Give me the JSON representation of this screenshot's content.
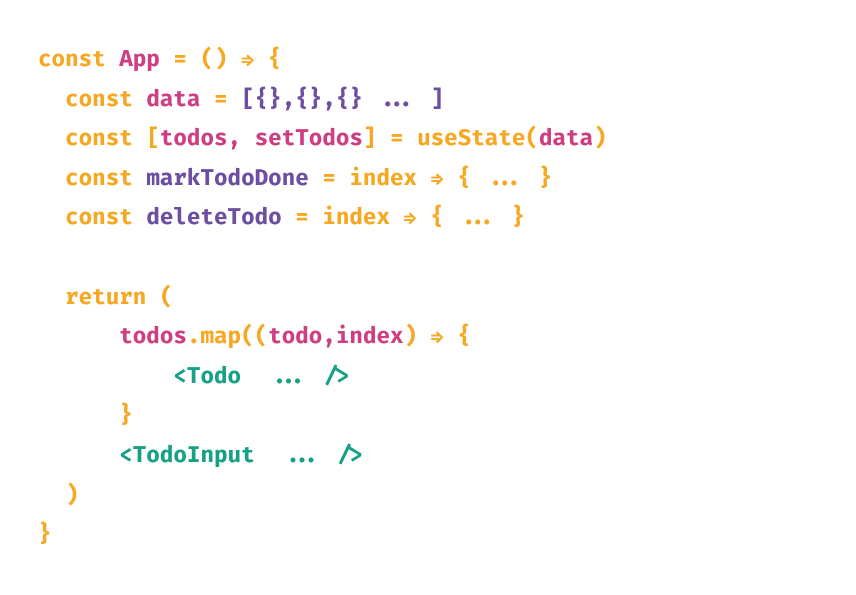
{
  "colors": {
    "orange": "#F6A823",
    "pink": "#CE3E82",
    "purple": "#6C4FA0",
    "teal": "#16A085"
  },
  "code": {
    "lines": [
      {
        "indent": 0,
        "tokens": [
          {
            "t": "const ",
            "c": "orange"
          },
          {
            "t": "App",
            "c": "pink"
          },
          {
            "t": " = () ",
            "c": "orange"
          },
          {
            "t": "⇒",
            "c": "orange"
          },
          {
            "t": " {",
            "c": "orange"
          }
        ]
      },
      {
        "indent": 1,
        "tokens": [
          {
            "t": "const ",
            "c": "orange"
          },
          {
            "t": "data",
            "c": "pink"
          },
          {
            "t": " = ",
            "c": "orange"
          },
          {
            "t": "[{},{},{} ... ]",
            "c": "purple"
          }
        ]
      },
      {
        "indent": 1,
        "tokens": [
          {
            "t": "const ",
            "c": "orange"
          },
          {
            "t": "[",
            "c": "orange"
          },
          {
            "t": "todos, setTodos",
            "c": "pink"
          },
          {
            "t": "] = ",
            "c": "orange"
          },
          {
            "t": "useState(",
            "c": "orange"
          },
          {
            "t": "data",
            "c": "pink"
          },
          {
            "t": ")",
            "c": "orange"
          }
        ]
      },
      {
        "indent": 1,
        "tokens": [
          {
            "t": "const ",
            "c": "orange"
          },
          {
            "t": "markTodoDone",
            "c": "purple"
          },
          {
            "t": " = index ⇒ { ... }",
            "c": "orange"
          }
        ]
      },
      {
        "indent": 1,
        "tokens": [
          {
            "t": "const ",
            "c": "orange"
          },
          {
            "t": "deleteTodo",
            "c": "purple"
          },
          {
            "t": " = index ⇒ { ... }",
            "c": "orange"
          }
        ]
      },
      {
        "indent": 0,
        "tokens": [
          {
            "t": " ",
            "c": "orange"
          }
        ]
      },
      {
        "indent": 1,
        "tokens": [
          {
            "t": "return (",
            "c": "orange"
          }
        ]
      },
      {
        "indent": 3,
        "tokens": [
          {
            "t": "todos",
            "c": "pink"
          },
          {
            "t": ".map(",
            "c": "orange"
          },
          {
            "t": "(",
            "c": "orange"
          },
          {
            "t": "todo,index",
            "c": "pink"
          },
          {
            "t": ") ",
            "c": "orange"
          },
          {
            "t": "⇒ {",
            "c": "orange"
          }
        ]
      },
      {
        "indent": 5,
        "tokens": [
          {
            "t": "<Todo  ... />",
            "c": "teal"
          }
        ]
      },
      {
        "indent": 3,
        "tokens": [
          {
            "t": "}",
            "c": "orange"
          }
        ]
      },
      {
        "indent": 3,
        "tokens": [
          {
            "t": "<TodoInput  ... />",
            "c": "teal"
          }
        ]
      },
      {
        "indent": 1,
        "tokens": [
          {
            "t": ")",
            "c": "orange"
          }
        ]
      },
      {
        "indent": 0,
        "tokens": [
          {
            "t": "}",
            "c": "orange"
          }
        ]
      }
    ]
  }
}
